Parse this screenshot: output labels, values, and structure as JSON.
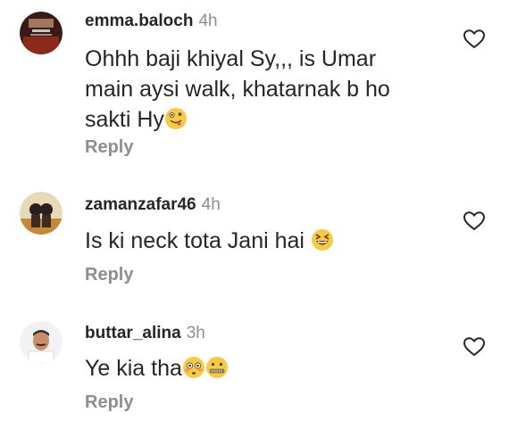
{
  "comments": [
    {
      "username": "emma.baloch",
      "time": "4h",
      "text_lines": [
        "Ohhh baji khiyal Sy,,, is Umar",
        "main aysi walk, khatarnak b ho",
        "sakti Hy"
      ],
      "emoji": [
        "zany-face"
      ],
      "reply_label": "Reply",
      "avatar": "avatar-image"
    },
    {
      "username": "zamanzafar46",
      "time": "4h",
      "text_lines": [
        "Is ki neck tota Jani hai "
      ],
      "emoji": [
        "laughing-squint-face"
      ],
      "reply_label": "Reply",
      "avatar": "avatar-image"
    },
    {
      "username": "buttar_alina",
      "time": "3h",
      "text_lines": [
        "Ye kia tha"
      ],
      "emoji": [
        "flushed-face",
        "zipper-mouth-face"
      ],
      "reply_label": "Reply",
      "avatar": "avatar-image"
    }
  ],
  "colors": {
    "text": "#262626",
    "secondary": "#8e8e8e",
    "emoji": "#f7c948"
  },
  "icons": [
    "heart-outline-icon"
  ]
}
